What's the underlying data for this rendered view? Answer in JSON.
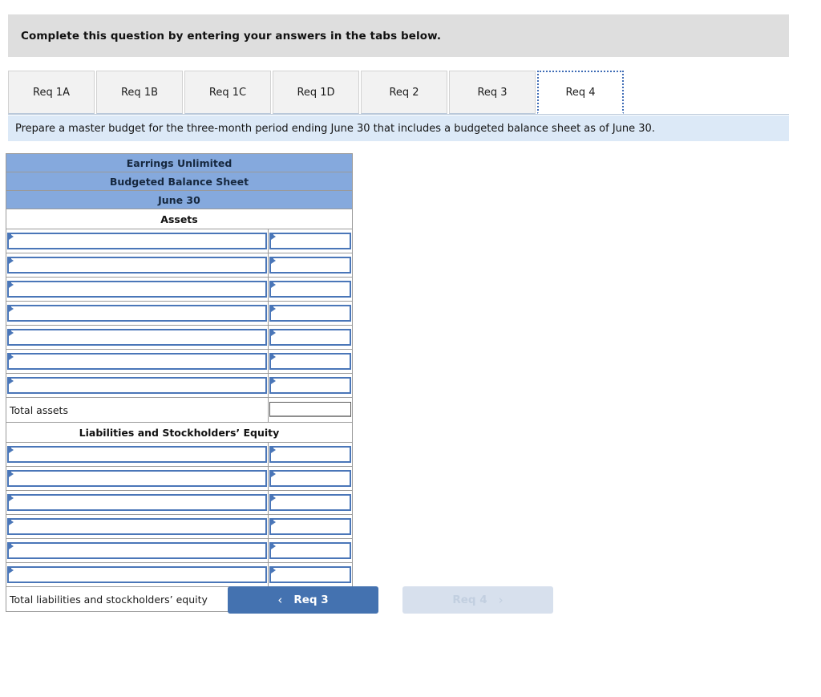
{
  "instruction": {
    "text": "Complete this question by entering your answers in the tabs below."
  },
  "tabs": {
    "items": [
      {
        "label": "Req 1A",
        "active": false
      },
      {
        "label": "Req 1B",
        "active": false
      },
      {
        "label": "Req 1C",
        "active": false
      },
      {
        "label": "Req 1D",
        "active": false
      },
      {
        "label": "Req 2",
        "active": false
      },
      {
        "label": "Req 3",
        "active": false
      },
      {
        "label": "Req 4",
        "active": true
      }
    ]
  },
  "requirement": {
    "text": "Prepare a master budget for the three-month period ending June 30 that includes a budgeted balance sheet as of June 30."
  },
  "balance_sheet": {
    "company": "Earrings Unlimited",
    "statement": "Budgeted Balance Sheet",
    "date": "June 30",
    "assets_heading": "Assets",
    "assets_rows": [
      {
        "label": "",
        "amount": ""
      },
      {
        "label": "",
        "amount": ""
      },
      {
        "label": "",
        "amount": ""
      },
      {
        "label": "",
        "amount": ""
      },
      {
        "label": "",
        "amount": ""
      },
      {
        "label": "",
        "amount": ""
      },
      {
        "label": "",
        "amount": ""
      }
    ],
    "total_assets_label": "Total assets",
    "total_assets_amount": "",
    "liabilities_heading": "Liabilities and Stockholders’ Equity",
    "liabilities_rows": [
      {
        "label": "",
        "amount": ""
      },
      {
        "label": "",
        "amount": ""
      },
      {
        "label": "",
        "amount": ""
      },
      {
        "label": "",
        "amount": ""
      },
      {
        "label": "",
        "amount": ""
      },
      {
        "label": "",
        "amount": ""
      }
    ],
    "total_liabilities_label": "Total liabilities and stockholders’ equity",
    "total_liabilities_amount": ""
  },
  "navigation": {
    "prev_label": "Req 3",
    "prev_icon": "chevron-left-icon",
    "prev_glyph": "‹",
    "next_label": "Req 4",
    "next_icon": "chevron-right-icon",
    "next_glyph": "›",
    "next_disabled": true
  },
  "colors": {
    "banner_gray": "#dedede",
    "prompt_blue": "#dce9f7",
    "header_blue": "#85a9dd",
    "input_border_blue": "#4a76b8",
    "button_blue": "#4472b0",
    "button_disabled": "#d7e0ed",
    "tab_inactive": "#f2f2f2"
  }
}
